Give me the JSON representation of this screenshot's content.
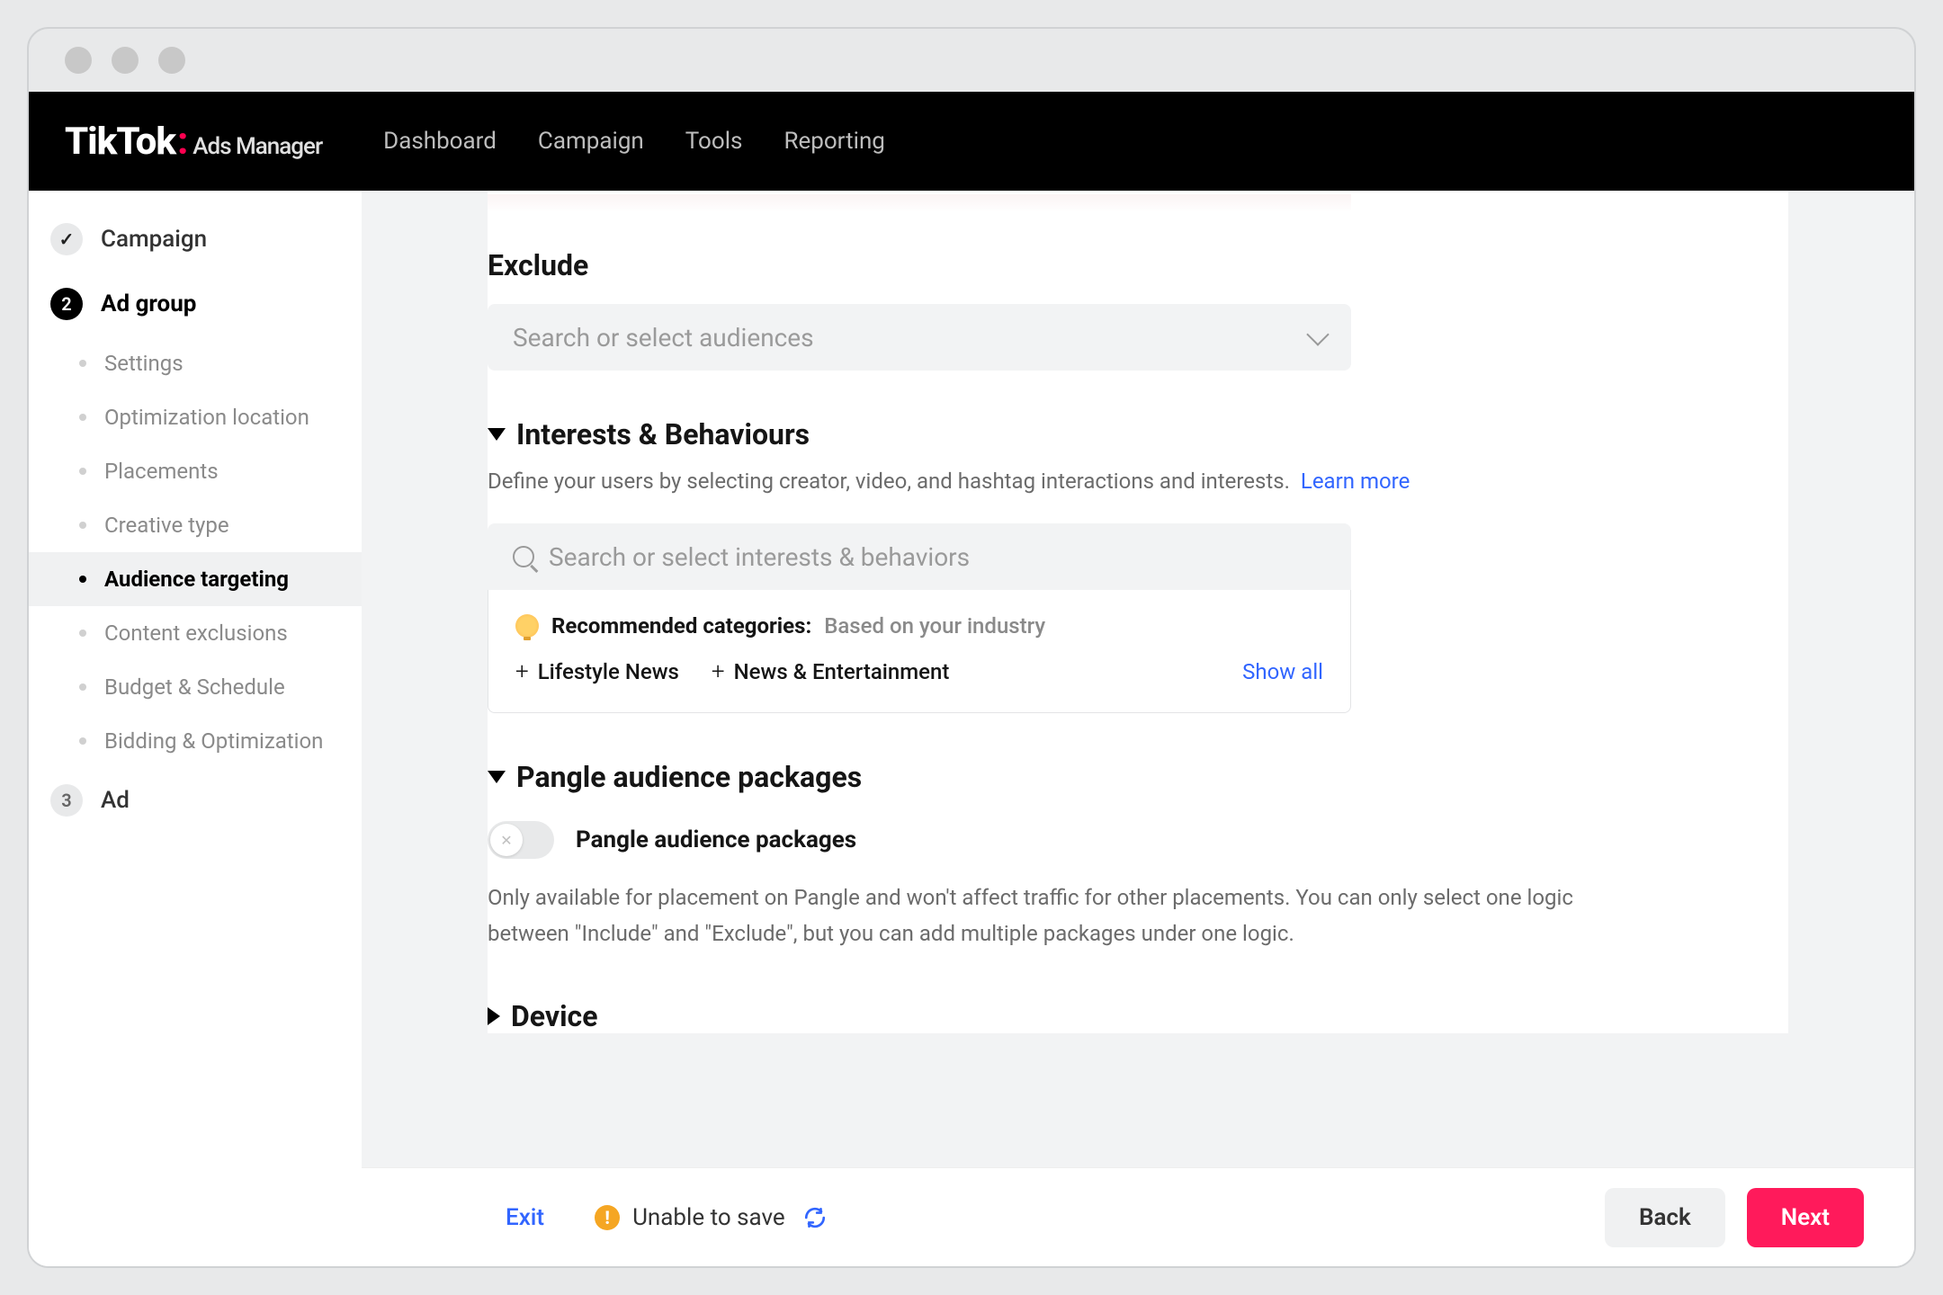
{
  "brand": {
    "name": "TikTok",
    "sub": "Ads Manager"
  },
  "nav": [
    "Dashboard",
    "Campaign",
    "Tools",
    "Reporting"
  ],
  "steps": {
    "campaign": "Campaign",
    "adgroup": "Ad group",
    "ad": "Ad",
    "adgroup_num": "2",
    "ad_num": "3"
  },
  "subitems": {
    "settings": "Settings",
    "optimization": "Optimization location",
    "placements": "Placements",
    "creative": "Creative type",
    "audience": "Audience targeting",
    "content_ex": "Content exclusions",
    "budget": "Budget & Schedule",
    "bidding": "Bidding & Optimization"
  },
  "exclude": {
    "heading": "Exclude",
    "placeholder": "Search or select audiences"
  },
  "interests": {
    "title": "Interests & Behaviours",
    "desc": "Define your users by selecting creator, video, and hashtag interactions and interests.",
    "learn": "Learn more",
    "search_placeholder": "Search or select interests & behaviors",
    "rec_label": "Recommended categories:",
    "rec_sub": "Based on your industry",
    "chip1": "Lifestyle News",
    "chip2": "News & Entertainment",
    "show_all": "Show all"
  },
  "pangle": {
    "title": "Pangle audience packages",
    "toggle_label": "Pangle audience packages",
    "helper": "Only available for placement on Pangle and won't affect traffic for other placements. You can only select one logic between \"Include\" and \"Exclude\", but you can add multiple packages under one logic."
  },
  "device": {
    "title": "Device"
  },
  "footer": {
    "exit": "Exit",
    "status": "Unable to save",
    "back": "Back",
    "next": "Next"
  }
}
